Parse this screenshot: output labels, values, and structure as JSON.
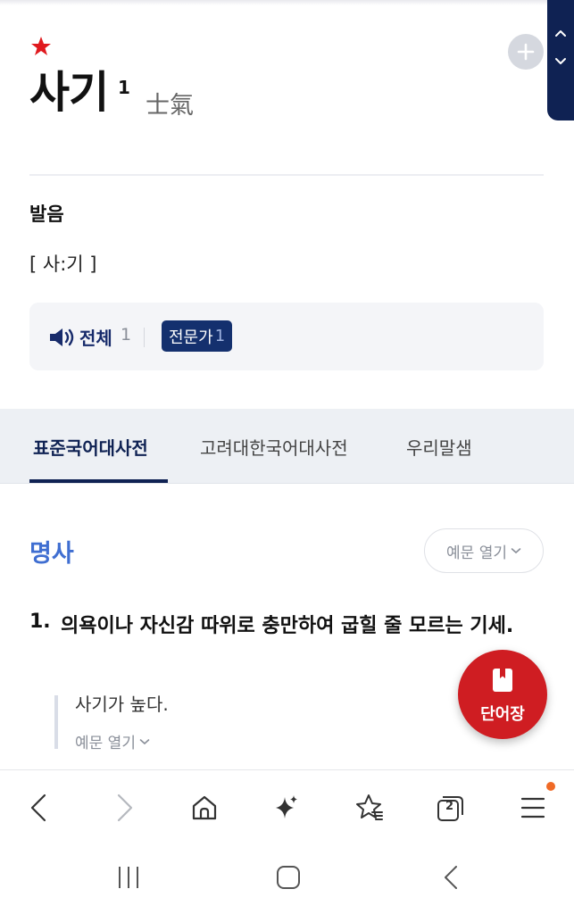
{
  "entry": {
    "title": "사기",
    "homonym_number": "1",
    "hanja": "士氣"
  },
  "pronunciation": {
    "heading": "발음",
    "text": "[ 사:기 ]"
  },
  "audio": {
    "all_label": "전체",
    "all_count": "1",
    "expert_label": "전문가",
    "expert_count": "1"
  },
  "tabs": [
    {
      "label": "표준국어대사전",
      "active": true
    },
    {
      "label": "고려대한국어대사전",
      "active": false
    },
    {
      "label": "우리말샘",
      "active": false
    }
  ],
  "sense": {
    "part_of_speech": "명사",
    "example_toggle": "예문 열기",
    "number": "1.",
    "definition": "의욕이나 자신감 따위로 충만하여 굽힐 줄 모르는 기세.",
    "example_sentence": "사기가 높다.",
    "example_more": "예문 열기"
  },
  "fab": {
    "label": "단어장"
  },
  "browser_nav": {
    "tab_count": "2",
    "icons": [
      "back-icon",
      "forward-icon",
      "home-icon",
      "sparkle-icon",
      "bookmark-star-icon",
      "tabs-icon",
      "menu-icon"
    ]
  },
  "colors": {
    "accent_navy": "#0f2253",
    "pos_blue": "#3f6ed1",
    "fab_red": "#cf1d22",
    "star_red": "#e0191e",
    "notification_orange": "#f06a26"
  }
}
